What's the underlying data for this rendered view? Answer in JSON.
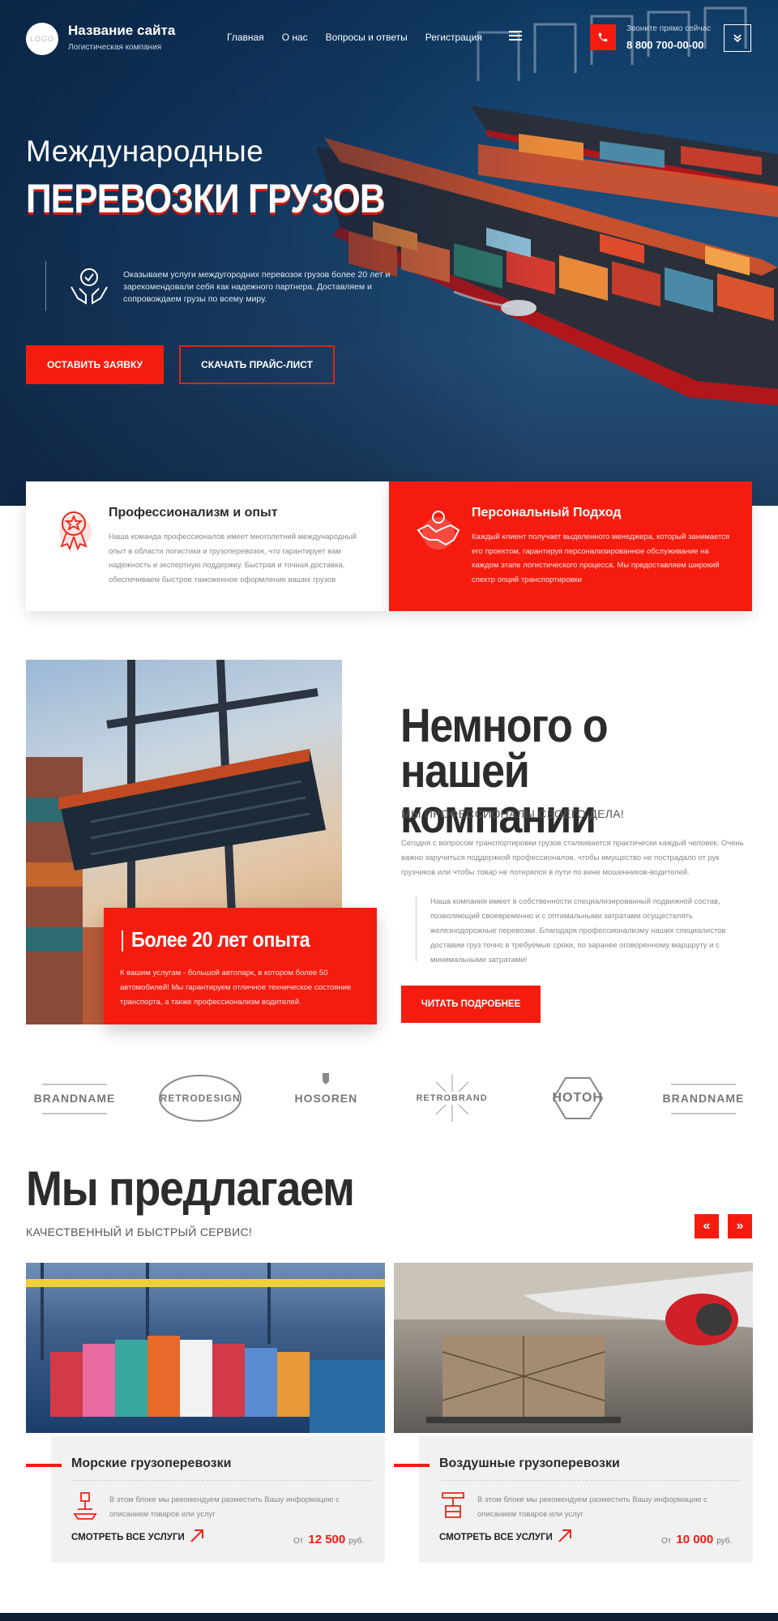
{
  "header": {
    "logo_text": "LOGO",
    "site_title": "Название сайта",
    "site_subtitle": "Логистическая компания",
    "nav": [
      "Главная",
      "О нас",
      "Вопросы и ответы",
      "Регистрация"
    ],
    "call_hint": "Звоните прямо сейчас",
    "phone": "8 800 700-00-00"
  },
  "hero": {
    "line1": "Международные",
    "line2": "ПЕРЕВОЗКИ ГРУЗОВ",
    "text": "Оказываем услуги междугородних перевозок грузов более 20 лет и зарекомендовали  себя как надежного партнера. Доставляем и сопровождаем грузы по всему миру.",
    "btn_primary": "ОСТАВИТЬ ЗАЯВКУ",
    "btn_secondary": "СКАЧАТЬ ПРАЙС-ЛИСТ"
  },
  "features": [
    {
      "title": "Профессионализм и опыт",
      "text": "Наша команда профессионалов имеет многолетний международный опыт в области логистики и грузоперевозок, что гарантирует вам надежность и экспертную поддержку. Быстрая и точная доставка, обеспечиваем быстрое таможенное оформление ваших грузов",
      "icon": "award-icon"
    },
    {
      "title": "Персональный Подход",
      "text": "Каждый клиент получает выделенного менеджера, который занимается его проектом, гарантируя персонализированное обслуживание на каждом этапе логистического процесса. Мы предоставляем широкий спектр опций транспортировки",
      "icon": "handshake-icon"
    }
  ],
  "about": {
    "experience_title": "Более 20 лет опыта",
    "experience_text": "К вашим услугам - большой автопарк, в котором более 50 автомобилей! Мы гарантируем отличное техническое состояние транспорта, а также профессионализм водителей.",
    "title": "Немного о нашей компании",
    "subtitle": "МЫ ПРОФЕССИОНАЛЫ СВОЕГО ДЕЛА!",
    "paragraph1": "Сегодня с вопросом транспортировки грузов сталкивается практически каждый человек. Очень важно заручиться поддержкой профессионалов, чтобы имущество не пострадало от рук грузчиков или чтобы товар не потерялся в пути по вине мошенников-водителей.",
    "paragraph2": "Наша компания имеет в собственности специализированный подвижной состав, позволяющий своевременно и с оптимальными затратами осуществлять железнодорожные перевозки. Благодаря профессионализму наших специалистов доставим груз точно в требуемые сроки, по заранее оговоренному маршруту и с минимальными затратами!",
    "button": "ЧИТАТЬ ПОДРОБНЕЕ"
  },
  "brands": [
    "BRANDNAME",
    "RETRODESIGN",
    "HOSOREN",
    "RETROBRAND",
    "HOTOH",
    "BRANDNAME"
  ],
  "offer": {
    "title": "Мы предлагаем",
    "subtitle": "КАЧЕСТВЕННЫЙ И БЫСТРЫЙ СЕРВИС!",
    "prev": "«",
    "next": "»",
    "cards": [
      {
        "title": "Морские грузоперевозки",
        "text": "В этом блоке мы рекомендуем разместить Вашу информацию с описанием товаров или услуг",
        "link": "СМОТРЕТЬ ВСЕ УСЛУГИ",
        "price_prefix": "От",
        "price": "12 500",
        "price_unit": "руб."
      },
      {
        "title": "Воздушные грузоперевозки",
        "text": "В этом блоке мы рекомендуем разместить Вашу информацию с описанием товаров или услуг",
        "link": "СМОТРЕТЬ ВСЕ УСЛУГИ",
        "price_prefix": "От",
        "price": "10 000",
        "price_unit": "руб."
      }
    ]
  },
  "colors": {
    "accent": "#f51c0f",
    "dark_text": "#2c2c2c",
    "hero_blue": "#1c4f7c"
  }
}
